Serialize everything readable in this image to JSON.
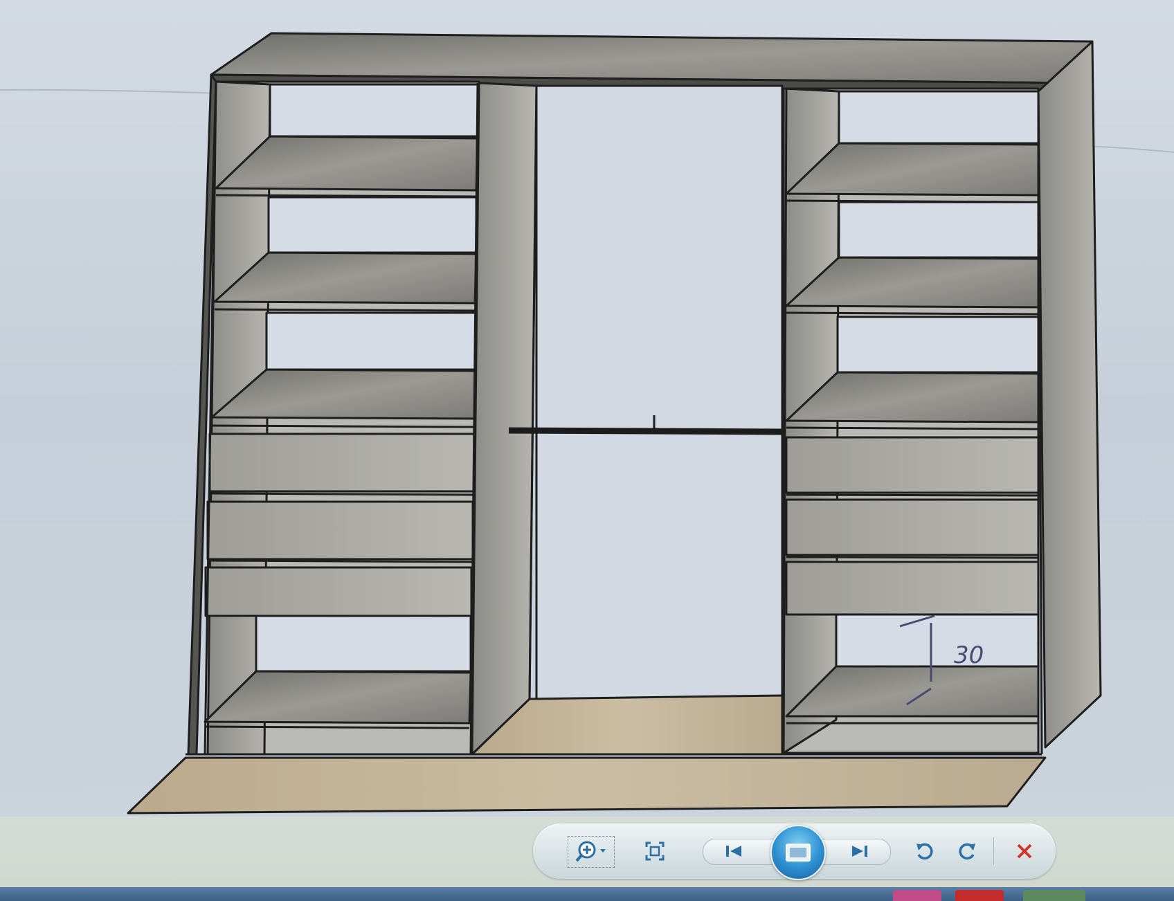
{
  "window": {
    "title": ""
  },
  "drawing": {
    "annotation_text": "30"
  },
  "toolbar": {
    "buttons": [
      {
        "name": "zoom-button",
        "icon": "zoom-in-icon",
        "has_dropdown": true
      },
      {
        "name": "actual-size-button",
        "icon": "fit-to-window-icon"
      },
      {
        "name": "previous-button",
        "icon": "previous-icon"
      },
      {
        "name": "slideshow-button",
        "icon": "slideshow-icon"
      },
      {
        "name": "next-button",
        "icon": "next-icon"
      },
      {
        "name": "rotate-counterclockwise-button",
        "icon": "rotate-ccw-icon"
      },
      {
        "name": "rotate-clockwise-button",
        "icon": "rotate-cw-icon"
      },
      {
        "name": "delete-button",
        "icon": "delete-icon"
      }
    ]
  },
  "colors": {
    "icon": "#2b6fa5",
    "delete": "#d2352c",
    "panel_dark": "#7c7c78",
    "panel_light": "#bdbcb7",
    "floor": "#c2b39a",
    "wall": "#c9d1db",
    "rod": "#1c1c1c"
  }
}
